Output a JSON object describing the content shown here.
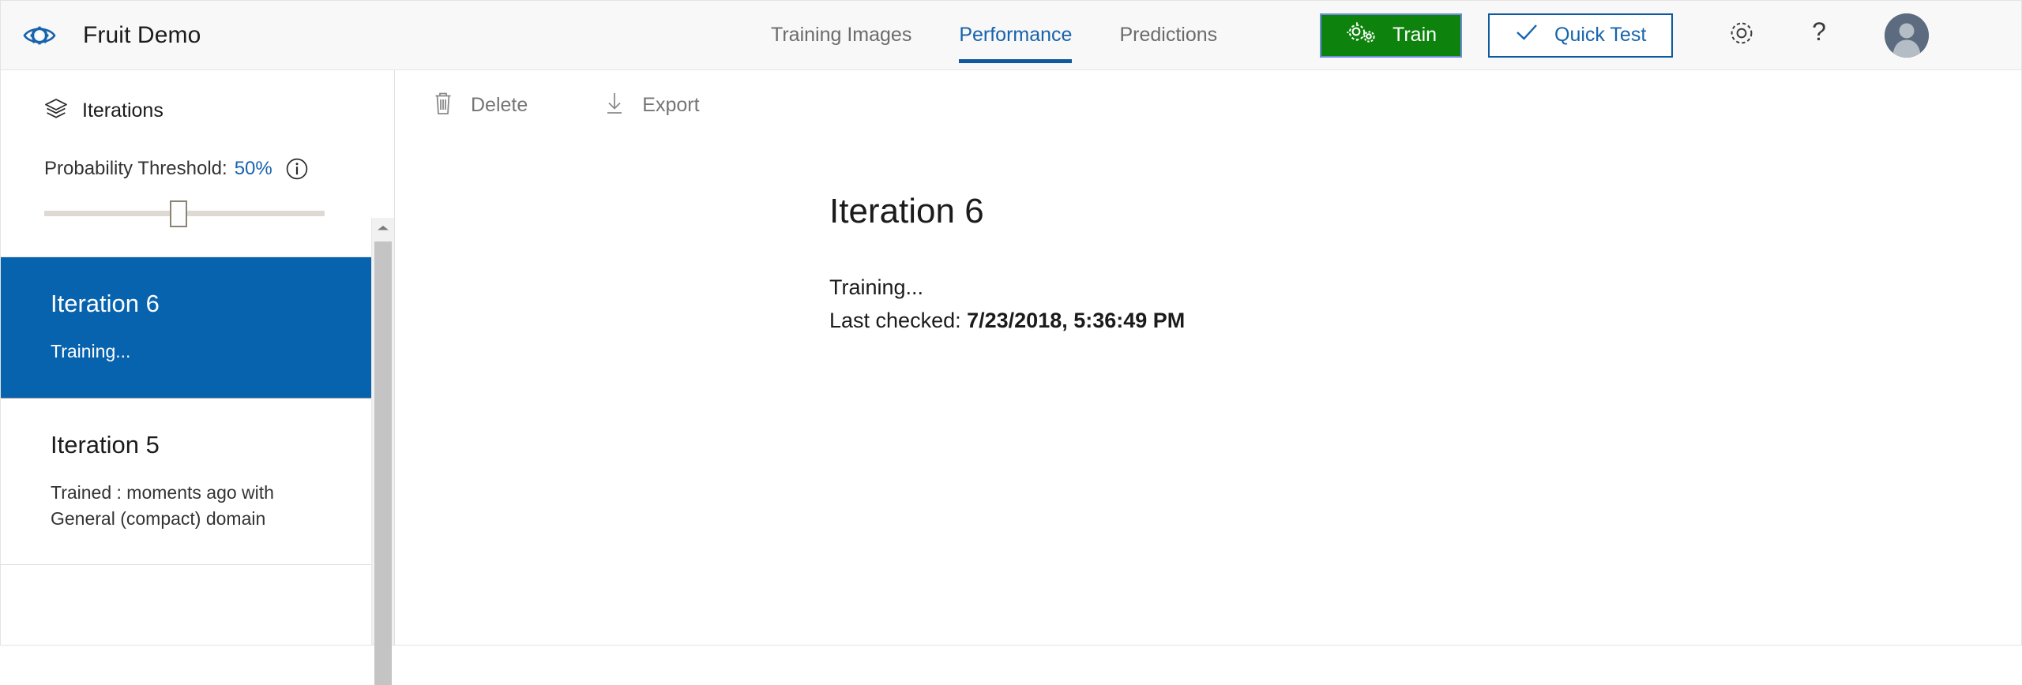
{
  "header": {
    "logo_icon": "eye-gear-icon",
    "title": "Fruit Demo",
    "nav": [
      {
        "label": "Training Images",
        "active": false
      },
      {
        "label": "Performance",
        "active": true
      },
      {
        "label": "Predictions",
        "active": false
      }
    ],
    "train_button": {
      "label": "Train",
      "icon": "gears-icon",
      "color": "#0d830d"
    },
    "quick_test_button": {
      "label": "Quick Test",
      "icon": "check-icon",
      "color": "#1763ad"
    },
    "settings_icon": "gear-icon",
    "help_icon": "question-mark-icon",
    "avatar_icon": "user-avatar-icon"
  },
  "sidebar": {
    "heading": {
      "label": "Iterations",
      "icon": "layers-icon"
    },
    "threshold": {
      "label": "Probability Threshold:",
      "value": "50%",
      "info_icon": "info-circle-icon",
      "slider_percent": 48
    },
    "iterations": [
      {
        "title": "Iteration 6",
        "status": "Training...",
        "selected": true
      },
      {
        "title": "Iteration 5",
        "status": "Trained : moments ago with General (compact) domain",
        "selected": false
      }
    ],
    "scrollbar": {
      "up_arrow_icon": "chevron-up-icon"
    }
  },
  "toolbar": {
    "delete": {
      "label": "Delete",
      "icon": "trash-icon"
    },
    "export": {
      "label": "Export",
      "icon": "download-icon"
    }
  },
  "main": {
    "title": "Iteration 6",
    "status": "Training...",
    "last_checked_label": "Last checked: ",
    "last_checked_value": "7/23/2018, 5:36:49 PM"
  },
  "colors": {
    "accent_blue": "#0763ae",
    "link_blue": "#1763ad",
    "train_green": "#0d830d",
    "header_bg": "#f8f8f8",
    "muted_text": "#757575"
  }
}
